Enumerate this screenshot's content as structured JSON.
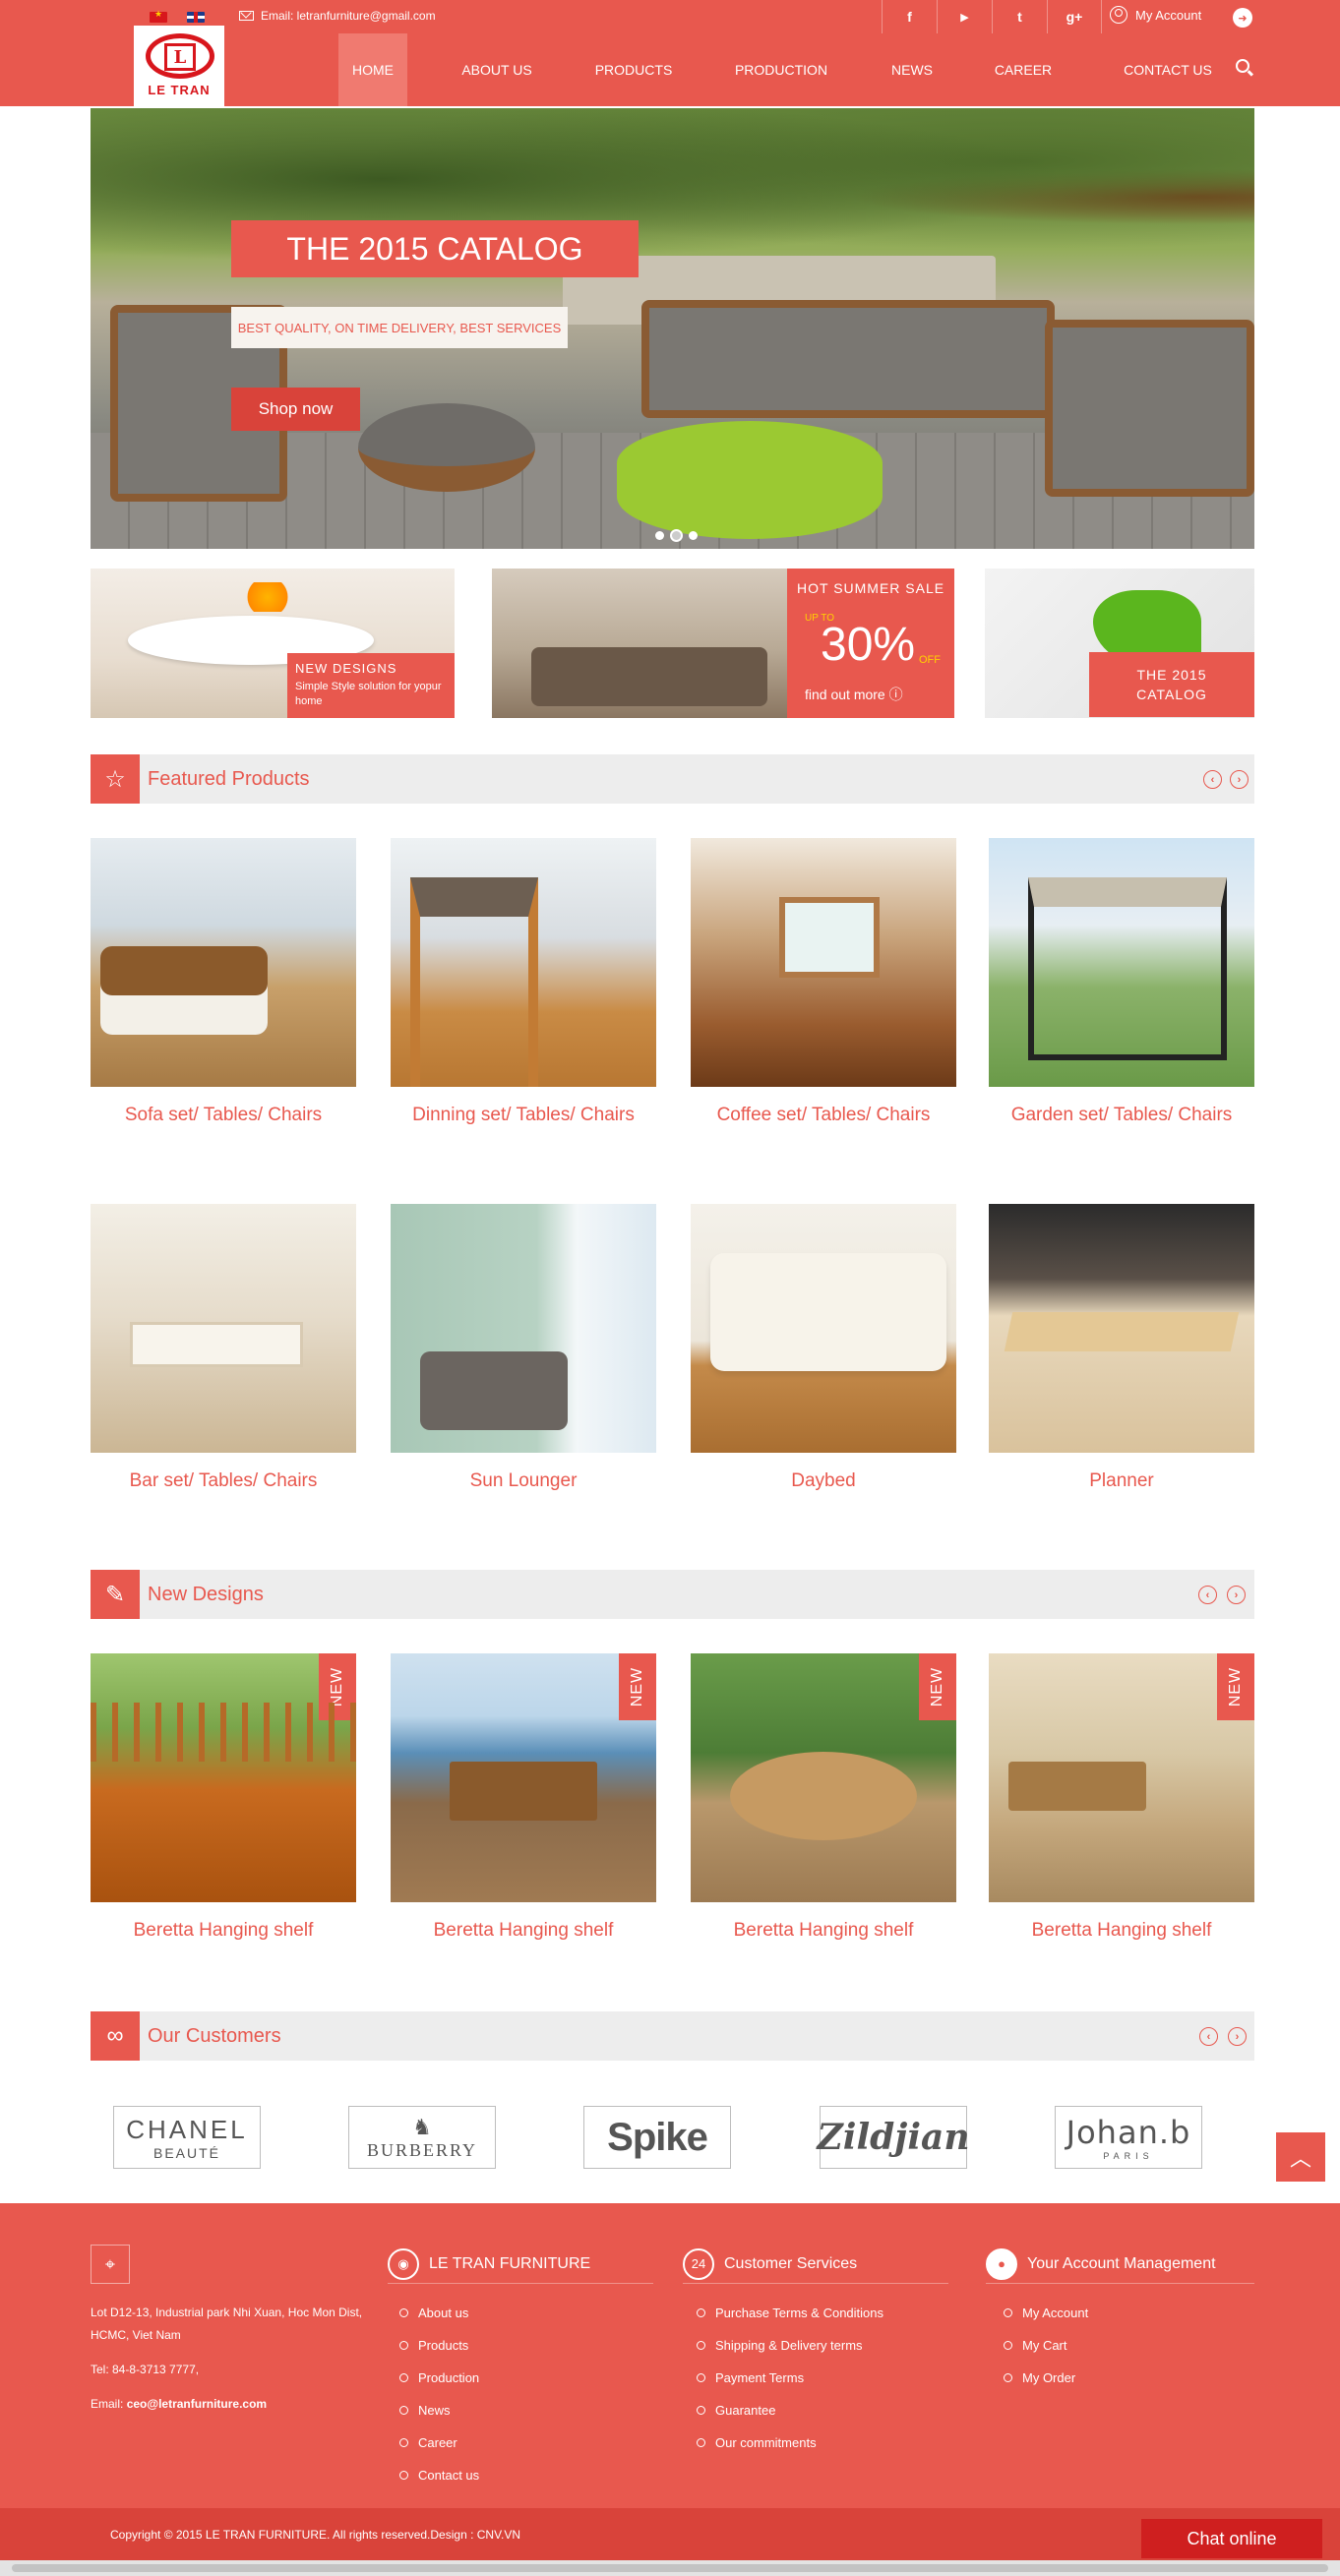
{
  "header": {
    "email_text": "Email: letranfurniture@gmail.com",
    "logo_text": "LE TRAN",
    "logo_letter": "L",
    "account_label": "My Account",
    "social": [
      "f",
      "▶",
      "t",
      "g+"
    ],
    "nav": [
      "HOME",
      "ABOUT US",
      "PRODUCTS",
      "PRODUCTION",
      "NEWS",
      "CAREER",
      "CONTACT US"
    ]
  },
  "hero": {
    "title": "THE 2015 CATALOG",
    "subtitle": "BEST QUALITY, ON TIME DELIVERY, BEST SERVICES",
    "button": "Shop now"
  },
  "promos": {
    "p1_title": "NEW DESIGNS",
    "p1_sub": "Simple Style solution for yopur home",
    "p2_title": "HOT SUMMER SALE",
    "p2_upto": "UP TO",
    "p2_pct": "30%",
    "p2_off": "OFF",
    "p2_more": "find out more",
    "p3_line1": "THE 2015",
    "p3_line2": "CATALOG"
  },
  "featured": {
    "title": "Featured Products",
    "items": [
      "Sofa set/ Tables/ Chairs",
      "Dinning set/ Tables/ Chairs",
      "Coffee set/ Tables/ Chairs",
      "Garden set/ Tables/ Chairs",
      "Bar set/ Tables/ Chairs",
      "Sun Lounger",
      "Daybed",
      "Planner"
    ]
  },
  "new_designs": {
    "title": "New Designs",
    "badge": "NEW",
    "items": [
      "Beretta Hanging shelf",
      "Beretta Hanging shelf",
      "Beretta Hanging shelf",
      "Beretta Hanging shelf"
    ]
  },
  "customers": {
    "title": "Our Customers",
    "chanel": "CHANEL",
    "chanel_sub": "BEAUTÉ",
    "burberry": "BURBERRY",
    "spike": "Spike",
    "zildjian": "Zildjian",
    "johan": "Johan.b",
    "johan_sub": "PARIS"
  },
  "footer": {
    "address": "Lot D12-13, Industrial park Nhi Xuan, Hoc Mon Dist, HCMC, Viet Nam",
    "tel": "Tel: 84-8-3713 7777,",
    "email_label": "Email: ",
    "email_value": "ceo@letranfurniture.com",
    "col2_title": "LE TRAN FURNITURE",
    "col2_links": [
      "About us",
      "Products",
      "Production",
      "News",
      "Career",
      "Contact us"
    ],
    "col3_title": "Customer Services",
    "col3_links": [
      "Purchase Terms & Conditions",
      "Shipping & Delivery terms",
      "Payment Terms",
      "Guarantee",
      "Our commitments"
    ],
    "col4_title": "Your Account Management",
    "col4_links": [
      "My Account",
      "My Cart",
      "My Order"
    ],
    "copyright": "Copyright © 2015 LE TRAN FURNITURE. All rights reserved.Design : CNV.VN",
    "chat": "Chat online"
  },
  "colors": {
    "brand_red": "#e8584e",
    "dark_red": "#d9433a",
    "chat_red": "#cf1f1f"
  }
}
